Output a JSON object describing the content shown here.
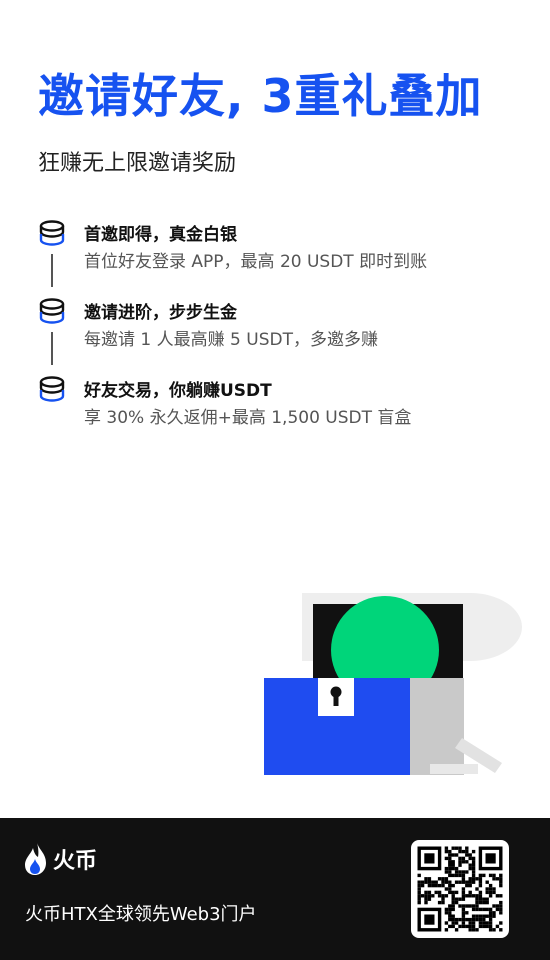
{
  "hero": {
    "title": "邀请好友, 3重礼叠加",
    "subtitle": "狂赚无上限邀请奖励"
  },
  "features": [
    {
      "icon": "coin-stack-icon",
      "title": "首邀即得，真金白银",
      "desc": "首位好友登录 APP，最高 20 USDT 即时到账"
    },
    {
      "icon": "coin-stack-icon",
      "title": "邀请进阶，步步生金",
      "desc": "每邀请 1 人最高赚 5 USDT，多邀多赚"
    },
    {
      "icon": "coin-stack-icon",
      "title": "好友交易，你躺赚USDT",
      "desc": "享 30% 永久返佣+最高 1,500 USDT 盲盒"
    }
  ],
  "illustration": {
    "icon": "treasure-chest-icon"
  },
  "footer": {
    "brand_name": "火币",
    "tagline": "火币HTX全球领先Web3门户",
    "qr_icon": "qr-code-icon"
  },
  "colors": {
    "accent": "#1652f0",
    "green": "#00d57a",
    "footer_bg": "#111111"
  }
}
